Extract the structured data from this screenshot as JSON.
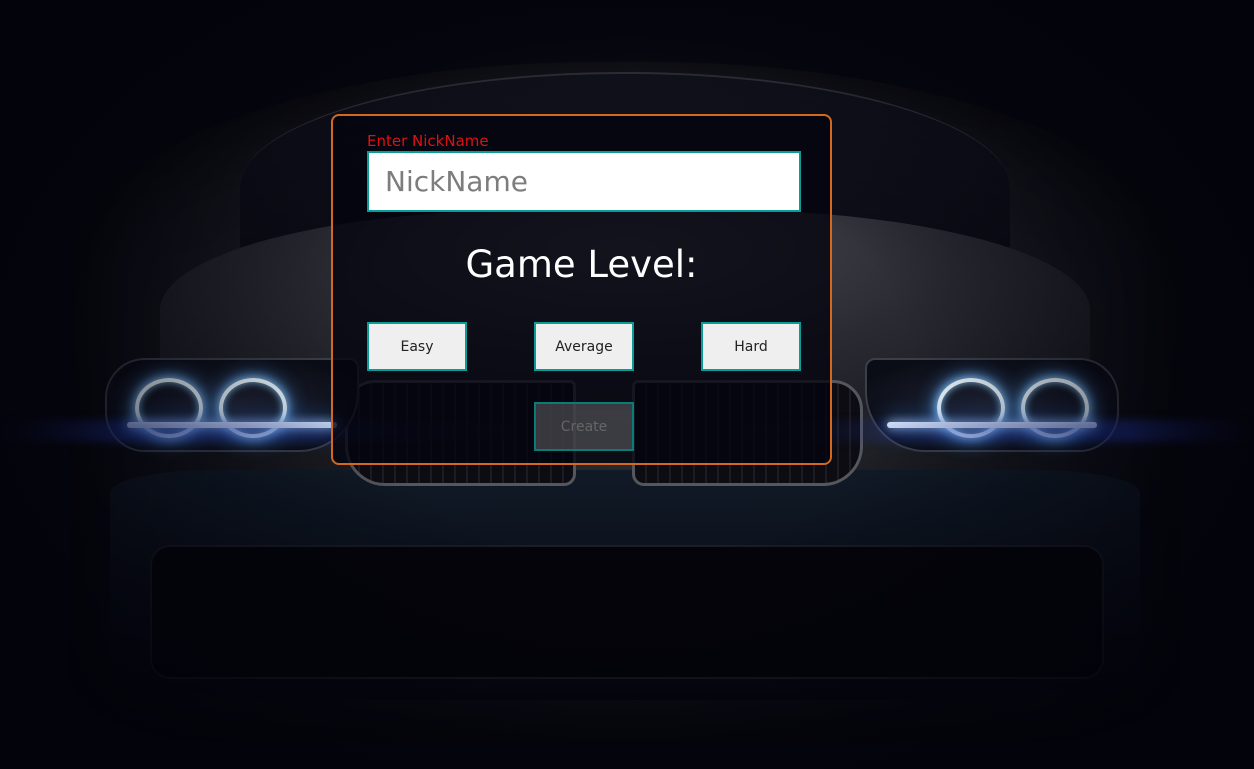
{
  "form": {
    "nickname_label": "Enter NickName",
    "nickname_placeholder": "NickName",
    "nickname_value": "",
    "level_title": "Game Level:",
    "levels": [
      {
        "label": "Easy"
      },
      {
        "label": "Average"
      },
      {
        "label": "Hard"
      }
    ],
    "create_label": "Create",
    "create_disabled": true
  },
  "colors": {
    "panel_border": "#d2691e",
    "label_text": "#e01010",
    "button_border": "#0a9c96",
    "background": "#05050f"
  }
}
